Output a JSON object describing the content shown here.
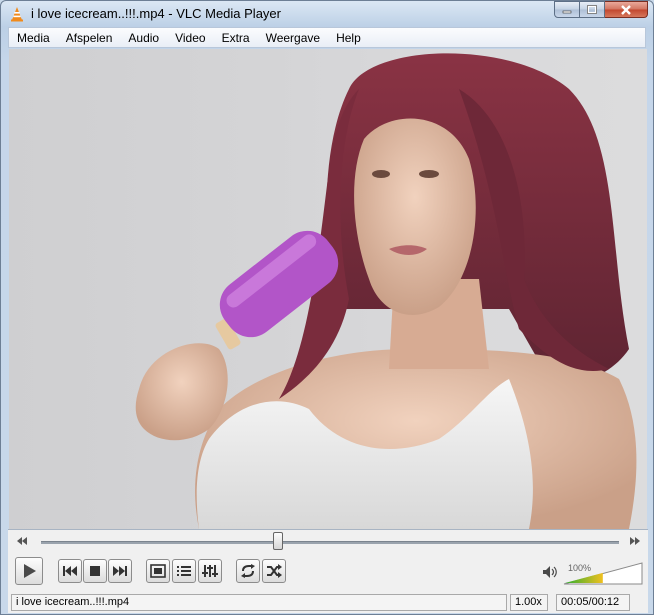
{
  "window": {
    "title": "i love icecream..!!!.mp4 - VLC Media Player"
  },
  "menu": [
    "Media",
    "Afspelen",
    "Audio",
    "Video",
    "Extra",
    "Weergave",
    "Help"
  ],
  "controls": {
    "seek_position": 0.41,
    "volume_percent": "100%",
    "volume_level": 1.0,
    "buttons": [
      {
        "name": "play",
        "icon": "play-icon"
      },
      {
        "name": "previous",
        "icon": "skip-back-icon"
      },
      {
        "name": "stop",
        "icon": "stop-icon"
      },
      {
        "name": "next",
        "icon": "skip-forward-icon"
      },
      {
        "name": "fullscreen",
        "icon": "fullscreen-icon"
      },
      {
        "name": "playlist",
        "icon": "playlist-icon"
      },
      {
        "name": "extended-settings",
        "icon": "equalizer-icon"
      },
      {
        "name": "loop",
        "icon": "loop-icon"
      },
      {
        "name": "shuffle",
        "icon": "shuffle-icon"
      }
    ]
  },
  "status": {
    "filename": "i love icecream..!!!.mp4",
    "speed": "1.00x",
    "time": "00:05/00:12"
  },
  "colors": {
    "accent": "#1e7a1e",
    "volume_gradient_start": "#2fae2f",
    "volume_gradient_end": "#f0c020"
  }
}
